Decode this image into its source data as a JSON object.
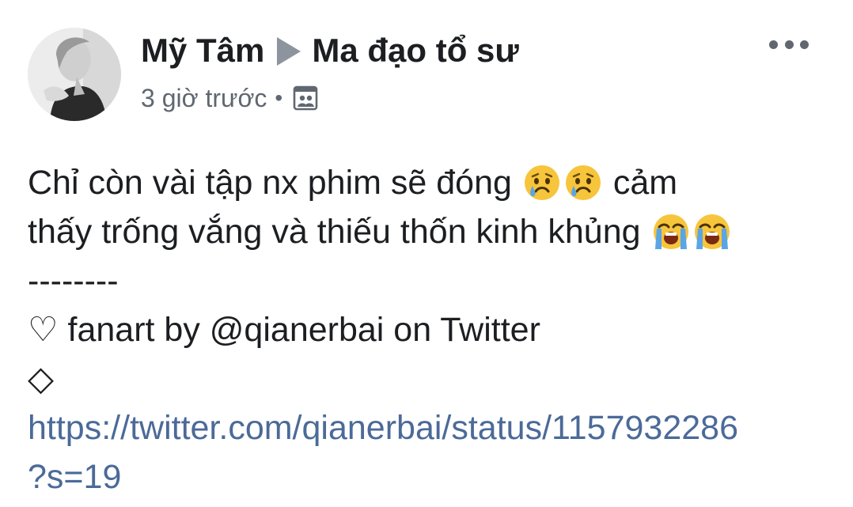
{
  "post": {
    "author": "Mỹ Tâm",
    "group": "Ma đạo tổ sư",
    "timestamp": "3 giờ trước",
    "separator": "•",
    "audience_icon": "photo-album-icon",
    "more_icon": "more-horizontal-icon"
  },
  "body": {
    "line1_text": "Chỉ còn vài tập nx phim sẽ đóng",
    "line1_tail": "cảm",
    "line2_text": "thấy trống vắng và thiếu thốn kinh khủng",
    "divider": "--------",
    "heart_glyph": "♡",
    "credit": "fanart by @qianerbai on Twitter",
    "diamond_glyph": "◇",
    "link_line1": "https://twitter.com/qianerbai/status/1157932286",
    "link_line2": "?s=19",
    "emojis": {
      "sad_1": "sad-tear-emoji",
      "sad_2": "sad-tear-emoji",
      "crying_1": "loudly-crying-emoji",
      "crying_2": "loudly-crying-emoji"
    }
  },
  "colors": {
    "text": "#1c1e21",
    "meta": "#606770",
    "link": "#4b6a99",
    "arrow": "#8d949e",
    "emoji_face": "#f7c53b",
    "tear": "#5aa5e6"
  }
}
